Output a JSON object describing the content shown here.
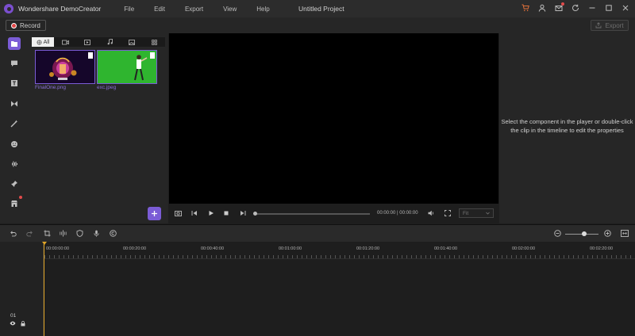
{
  "app": {
    "title": "Wondershare DemoCreator",
    "project_title": "Untitled Project"
  },
  "menu": [
    "File",
    "Edit",
    "Export",
    "View",
    "Help"
  ],
  "titlebar_icons": [
    "cart-icon",
    "user-icon",
    "mail-icon",
    "refresh-icon",
    "minimize-icon",
    "maximize-icon",
    "close-icon"
  ],
  "toolbar": {
    "record_label": "Record",
    "export_label": "Export"
  },
  "sidebar": [
    "media-icon",
    "caption-icon",
    "text-icon",
    "transition-icon",
    "effects-icon",
    "sticker-icon",
    "audio-icon",
    "pin-icon",
    "store-icon"
  ],
  "media": {
    "tabs": [
      {
        "label": "All",
        "icon": "all-icon"
      },
      {
        "label": "",
        "icon": "video-icon"
      },
      {
        "label": "",
        "icon": "screen-icon"
      },
      {
        "label": "",
        "icon": "music-icon"
      },
      {
        "label": "",
        "icon": "image-icon"
      },
      {
        "label": "",
        "icon": "grid-icon"
      }
    ],
    "files": [
      {
        "name": "FinalOne.png"
      },
      {
        "name": "exc.jpeg"
      }
    ]
  },
  "player": {
    "timecode": "00:00:00 | 00:00:00",
    "fit": "Fit"
  },
  "properties": {
    "message": "Select the component in the player or double-click the clip in the timeline to edit the properties"
  },
  "timeline": {
    "track_number": "01",
    "ruler_labels": [
      "00:00:00:00",
      "00:00:20:00",
      "00:00:40:00",
      "00:01:00:00",
      "00:01:20:00",
      "00:01:40:00",
      "00:02:00:00",
      "00:02:20:00"
    ],
    "zoom_level": 0.5
  },
  "colors": {
    "accent": "#7b5cd6",
    "playhead": "#e0a526",
    "record": "#e04646"
  }
}
